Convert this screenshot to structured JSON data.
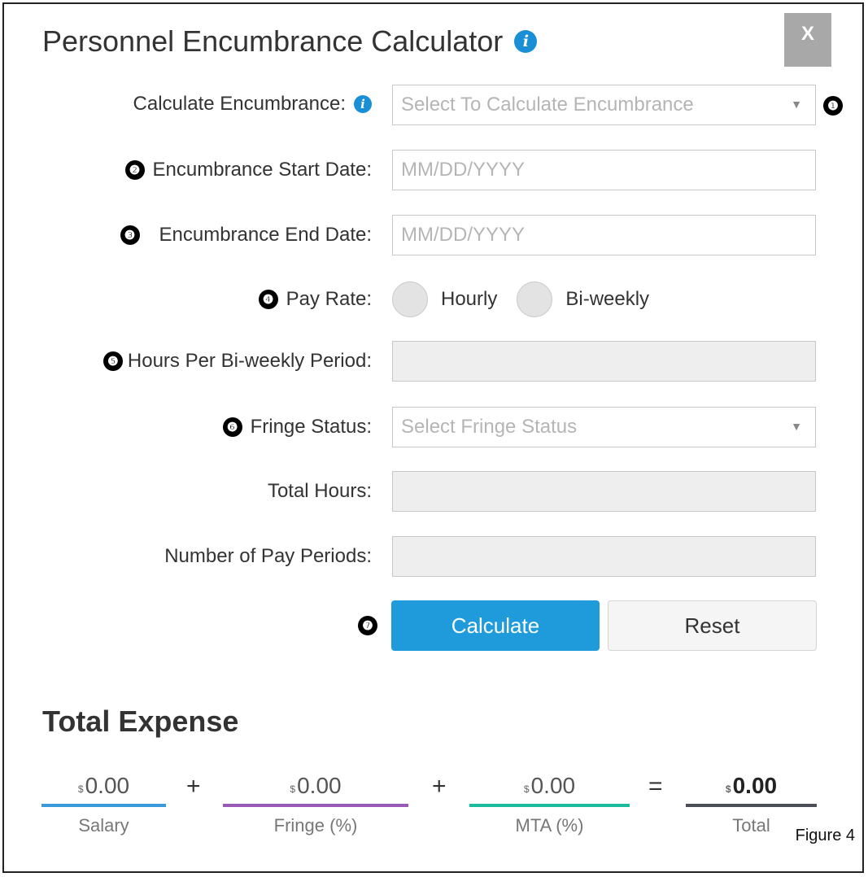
{
  "dialog": {
    "title": "Personnel Encumbrance Calculator",
    "close_label": "X"
  },
  "form": {
    "calculate_label": "Calculate Encumbrance:",
    "calculate_placeholder": "Select To Calculate Encumbrance",
    "start_label": "Encumbrance Start Date:",
    "start_placeholder": "MM/DD/YYYY",
    "end_label": "Encumbrance End Date:",
    "end_placeholder": "MM/DD/YYYY",
    "pay_rate_label": "Pay Rate:",
    "pay_rate_options": [
      "Hourly",
      "Bi-weekly"
    ],
    "hours_label": "Hours Per Bi-weekly Period:",
    "fringe_label": "Fringe Status:",
    "fringe_placeholder": "Select Fringe Status",
    "total_hours_label": "Total Hours:",
    "pay_periods_label": "Number of Pay Periods:"
  },
  "buttons": {
    "calculate": "Calculate",
    "reset": "Reset"
  },
  "markers": [
    "❶",
    "❷",
    "❸",
    "❹",
    "❺",
    "❻",
    "❼"
  ],
  "expense": {
    "title": "Total Expense",
    "currency": "$",
    "salary": {
      "amount": "0.00",
      "caption": "Salary",
      "color": "#3a9ad9"
    },
    "fringe": {
      "amount": "0.00",
      "caption": "Fringe (%)",
      "color": "#9b59b6"
    },
    "mta": {
      "amount": "0.00",
      "caption": "MTA (%)",
      "color": "#1abc9c"
    },
    "total": {
      "amount": "0.00",
      "caption": "Total",
      "color": "#4a4f55"
    },
    "plus": "+",
    "equals": "="
  },
  "figure_caption": "Figure 4",
  "colors": {
    "primary_button": "#1f9bdc",
    "info_icon": "#1a8fd6",
    "close_button": "#a8a8a8"
  },
  "icons": {
    "info": "info-circle-icon",
    "dropdown": "caret-down-icon"
  }
}
